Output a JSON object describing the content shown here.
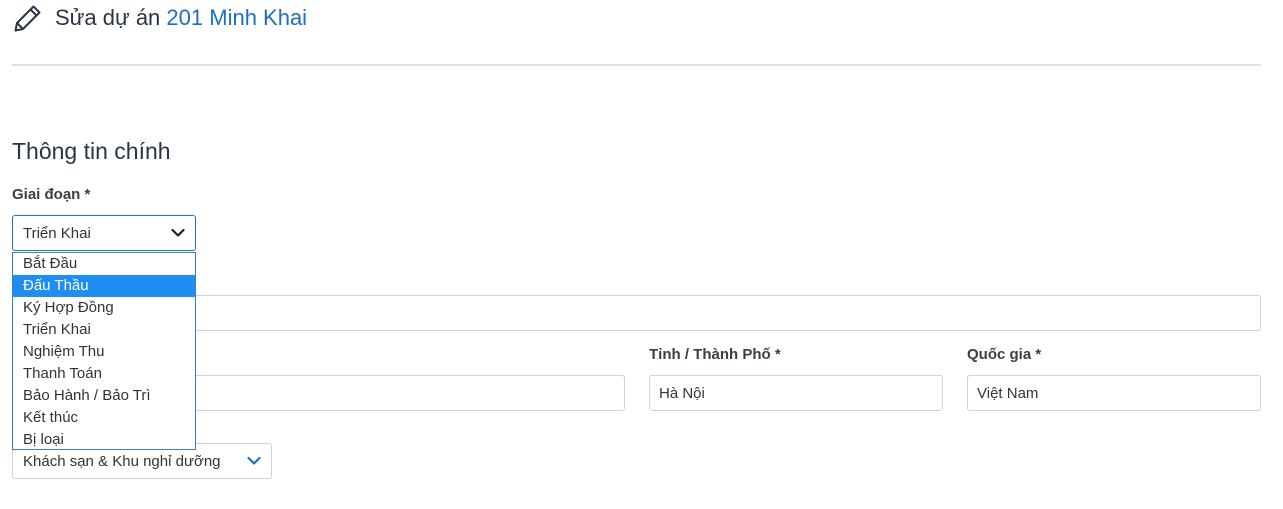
{
  "header": {
    "title_prefix": "Sửa dự án",
    "project_name": "201 Minh Khai"
  },
  "section": {
    "title": "Thông tin chính"
  },
  "stage": {
    "label": "Giai đoạn *",
    "selected": "Triển Khai",
    "options": [
      "Bắt Đầu",
      "Đấu Thầu",
      "Ký Hợp Đồng",
      "Triển Khai",
      "Nghiệm Thu",
      "Thanh Toán",
      "Bảo Hành / Bảo Trì",
      "Kết thúc",
      "Bị loại"
    ],
    "highlighted": "Đấu Thầu"
  },
  "province": {
    "label": "Tỉnh / Thành Phố *",
    "value": "Hà Nội"
  },
  "country": {
    "label": "Quốc gia *",
    "value": "Việt Nam"
  },
  "category": {
    "selected": "Khách sạn & Khu nghỉ dưỡng"
  },
  "colors": {
    "accent": "#1d6fc2",
    "highlight": "#1e8ef0"
  }
}
